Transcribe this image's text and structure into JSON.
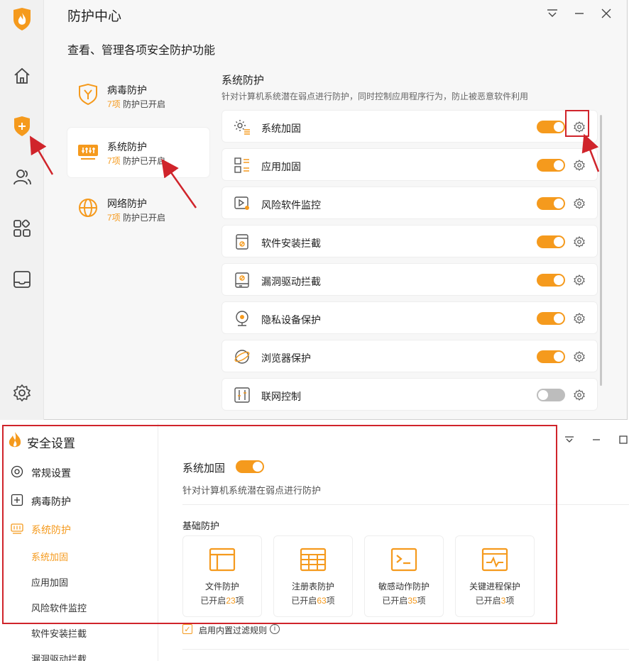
{
  "colors": {
    "accent": "#f59a1d",
    "annotation_red": "#d0242b",
    "toggle_off": "#bdbdbd"
  },
  "rail": {
    "items": [
      "home-icon",
      "shield-plus-icon",
      "users-icon",
      "apps-icon",
      "inbox-icon",
      "settings-icon"
    ]
  },
  "window": {
    "title": "防护中心",
    "subtitle": "查看、管理各项安全防护功能",
    "controls": [
      "menu-icon",
      "minimize-icon",
      "close-icon"
    ]
  },
  "categories": [
    {
      "name": "病毒防护",
      "count": "7项",
      "status": "防护已开启",
      "icon": "virus-shield-icon"
    },
    {
      "name": "系统防护",
      "count": "7项",
      "status": "防护已开启",
      "icon": "system-icon",
      "active": true
    },
    {
      "name": "网络防护",
      "count": "7项",
      "status": "防护已开启",
      "icon": "globe-icon"
    }
  ],
  "section": {
    "title": "系统防护",
    "description": "针对计算机系统潜在弱点进行防护，同时控制应用程序行为，防止被恶意软件利用"
  },
  "features": [
    {
      "label": "系统加固",
      "on": true,
      "icon": "gear-doc-icon"
    },
    {
      "label": "应用加固",
      "on": true,
      "icon": "app-grid-icon"
    },
    {
      "label": "风险软件监控",
      "on": true,
      "icon": "monitor-play-icon"
    },
    {
      "label": "软件安装拦截",
      "on": true,
      "icon": "package-block-icon"
    },
    {
      "label": "漏洞驱动拦截",
      "on": true,
      "icon": "driver-icon"
    },
    {
      "label": "隐私设备保护",
      "on": true,
      "icon": "webcam-icon"
    },
    {
      "label": "浏览器保护",
      "on": true,
      "icon": "browser-icon"
    },
    {
      "label": "联网控制",
      "on": false,
      "icon": "network-control-icon"
    }
  ],
  "settings_window": {
    "title": "安全设置",
    "controls": [
      "menu-icon",
      "minimize-icon",
      "maximize-icon"
    ],
    "nav": [
      {
        "label": "常规设置",
        "icon": "target-icon"
      },
      {
        "label": "病毒防护",
        "icon": "plus-box-icon"
      },
      {
        "label": "系统防护",
        "icon": "system-icon",
        "active": true
      }
    ],
    "subnav": [
      "系统加固",
      "应用加固",
      "风险软件监控",
      "软件安装拦截",
      "漏洞驱动拦截"
    ],
    "main": {
      "title": "系统加固",
      "description": "针对计算机系统潜在弱点进行防护",
      "basic_title": "基础防护",
      "cards": [
        {
          "title": "文件防护",
          "prefix": "已开启",
          "num": "23",
          "suffix": "项",
          "icon": "file-window-icon"
        },
        {
          "title": "注册表防护",
          "prefix": "已开启",
          "num": "63",
          "suffix": "项",
          "icon": "table-icon"
        },
        {
          "title": "敏感动作防护",
          "prefix": "已开启",
          "num": "35",
          "suffix": "项",
          "icon": "terminal-icon"
        },
        {
          "title": "关键进程保护",
          "prefix": "已开启",
          "num": "3",
          "suffix": "项",
          "icon": "pulse-window-icon"
        }
      ],
      "checkbox_label": "启用内置过滤规则"
    }
  }
}
